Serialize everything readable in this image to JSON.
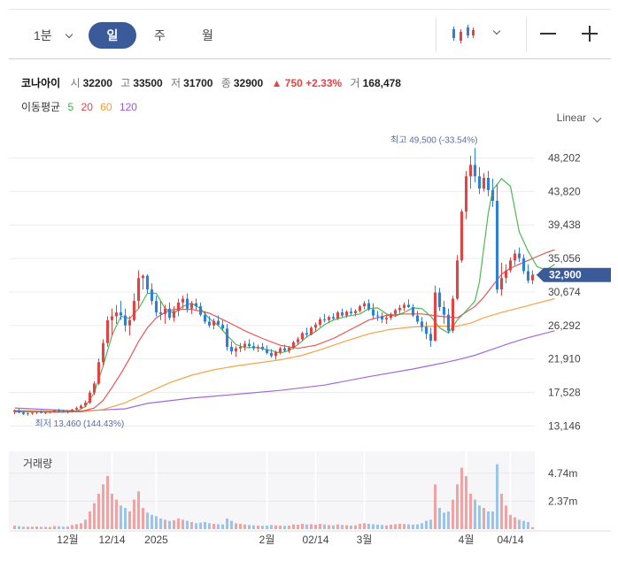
{
  "toolbar": {
    "interval_label": "1분",
    "periods": [
      "일",
      "주",
      "월"
    ],
    "active_period": "일"
  },
  "stock": {
    "name": "코나아이",
    "open_label": "시",
    "open": "32200",
    "high_label": "고",
    "high": "33500",
    "low_label": "저",
    "low": "31700",
    "close_label": "종",
    "close": "32900",
    "change": "▲ 750",
    "change_pct": "+2.33%",
    "volume_label": "거",
    "volume": "168,478"
  },
  "ma_legend": {
    "label": "이동평균",
    "items": [
      {
        "period": "5",
        "color": "#3cb043"
      },
      {
        "period": "20",
        "color": "#e64545"
      },
      {
        "period": "60",
        "color": "#f29a38"
      },
      {
        "period": "120",
        "color": "#9b59d0"
      }
    ]
  },
  "scale_mode": "Linear",
  "volume_title": "거래량",
  "colors": {
    "up": "#e04545",
    "down": "#2f7fd6",
    "accent": "#3a5a9a"
  },
  "chart_data": {
    "type": "candlestick",
    "y_ticks": [
      "48,202",
      "43,820",
      "39,438",
      "35,056",
      "30,674",
      "26,292",
      "21,910",
      "17,528",
      "13,146"
    ],
    "ylim": [
      11000,
      51500
    ],
    "current_price": "32,900",
    "high_annotation": "최고 49,500 (-33.54%)",
    "low_annotation": "최저 13,460 (144.43%)",
    "x_labels": [
      {
        "label": "12월",
        "index": 12
      },
      {
        "label": "12/14",
        "index": 22
      },
      {
        "label": "2025",
        "index": 32
      },
      {
        "label": "2월",
        "index": 57
      },
      {
        "label": "02/14",
        "index": 68
      },
      {
        "label": "3월",
        "index": 79
      },
      {
        "label": "4월",
        "index": 102
      },
      {
        "label": "04/14",
        "index": 112
      }
    ],
    "volume_ticks": [
      "4.74m",
      "2.37m"
    ],
    "volume_max": 6000000,
    "candles": [
      [
        15000,
        15300,
        14700,
        15200,
        300000
      ],
      [
        15200,
        15400,
        14800,
        14900,
        250000
      ],
      [
        14900,
        15100,
        14600,
        14700,
        220000
      ],
      [
        14700,
        14900,
        14500,
        14800,
        200000
      ],
      [
        14800,
        15000,
        14600,
        14900,
        210000
      ],
      [
        14900,
        15100,
        14700,
        15000,
        230000
      ],
      [
        15000,
        15200,
        14800,
        14850,
        200000
      ],
      [
        14850,
        15000,
        14700,
        14950,
        190000
      ],
      [
        14950,
        15100,
        14800,
        15000,
        180000
      ],
      [
        15000,
        15300,
        14900,
        15200,
        260000
      ],
      [
        15200,
        15400,
        14900,
        15100,
        240000
      ],
      [
        15100,
        15300,
        14900,
        15000,
        200000
      ],
      [
        15000,
        15200,
        14800,
        15050,
        220000
      ],
      [
        15050,
        15400,
        14900,
        15300,
        350000
      ],
      [
        15300,
        15700,
        15100,
        15500,
        420000
      ],
      [
        15500,
        16000,
        15300,
        15800,
        500000
      ],
      [
        15800,
        16500,
        15600,
        16200,
        800000
      ],
      [
        16200,
        17800,
        16000,
        17500,
        1500000
      ],
      [
        17500,
        19000,
        17200,
        18700,
        2200000
      ],
      [
        18700,
        22000,
        18500,
        21500,
        3000000
      ],
      [
        21500,
        24500,
        21000,
        24000,
        3800000
      ],
      [
        24000,
        27500,
        23500,
        27000,
        4500000
      ],
      [
        27000,
        28500,
        25000,
        27500,
        3000000
      ],
      [
        27500,
        29000,
        26500,
        28000,
        2500000
      ],
      [
        28000,
        29500,
        27000,
        27600,
        2000000
      ],
      [
        27600,
        28500,
        25500,
        26300,
        1800000
      ],
      [
        26300,
        27500,
        25000,
        27000,
        1500000
      ],
      [
        27000,
        30500,
        26800,
        29500,
        2500000
      ],
      [
        29500,
        33500,
        28500,
        32500,
        3200000
      ],
      [
        32500,
        33000,
        31000,
        32800,
        1800000
      ],
      [
        32800,
        33000,
        30500,
        31000,
        1400000
      ],
      [
        31000,
        31800,
        29000,
        29500,
        1200000
      ],
      [
        29500,
        30200,
        27500,
        28000,
        1100000
      ],
      [
        28000,
        29500,
        27000,
        27800,
        900000
      ],
      [
        27800,
        29000,
        26500,
        28500,
        800000
      ],
      [
        28500,
        29300,
        27000,
        27300,
        700000
      ],
      [
        27300,
        28800,
        26800,
        28200,
        750000
      ],
      [
        28200,
        29800,
        27500,
        29300,
        900000
      ],
      [
        29300,
        30200,
        28500,
        29800,
        800000
      ],
      [
        29800,
        30500,
        28000,
        28500,
        700000
      ],
      [
        28500,
        29500,
        27800,
        29200,
        600000
      ],
      [
        29200,
        29800,
        28300,
        28800,
        500000
      ],
      [
        28800,
        29300,
        27500,
        27700,
        550000
      ],
      [
        27700,
        28200,
        26500,
        26800,
        600000
      ],
      [
        26800,
        27500,
        26000,
        26300,
        500000
      ],
      [
        26300,
        27200,
        25800,
        26900,
        450000
      ],
      [
        26900,
        27600,
        26200,
        26400,
        420000
      ],
      [
        26400,
        27000,
        25600,
        25900,
        400000
      ],
      [
        25900,
        26500,
        23000,
        23500,
        900000
      ],
      [
        23500,
        24200,
        22500,
        22900,
        700000
      ],
      [
        22900,
        23600,
        22200,
        23300,
        500000
      ],
      [
        23300,
        24000,
        22800,
        23500,
        450000
      ],
      [
        23500,
        24300,
        23000,
        23900,
        400000
      ],
      [
        23900,
        24500,
        23300,
        23600,
        350000
      ],
      [
        23600,
        24100,
        23000,
        23300,
        320000
      ],
      [
        23300,
        23800,
        22800,
        23500,
        300000
      ],
      [
        23500,
        24000,
        23000,
        23200,
        280000
      ],
      [
        23200,
        23700,
        22500,
        22700,
        300000
      ],
      [
        22700,
        23200,
        22100,
        22300,
        350000
      ],
      [
        22300,
        23000,
        21800,
        22800,
        320000
      ],
      [
        22800,
        23500,
        22500,
        23300,
        300000
      ],
      [
        23300,
        23800,
        22800,
        23000,
        280000
      ],
      [
        23000,
        23600,
        22700,
        23400,
        300000
      ],
      [
        23400,
        24300,
        23200,
        24100,
        400000
      ],
      [
        24100,
        24800,
        23800,
        24500,
        380000
      ],
      [
        24500,
        25500,
        24300,
        25300,
        450000
      ],
      [
        25300,
        26000,
        24800,
        25100,
        400000
      ],
      [
        25100,
        26200,
        25000,
        26000,
        420000
      ],
      [
        26000,
        26700,
        25500,
        26400,
        380000
      ],
      [
        26400,
        27400,
        26100,
        27100,
        450000
      ],
      [
        27100,
        27800,
        26700,
        27000,
        400000
      ],
      [
        27000,
        27600,
        26600,
        27400,
        350000
      ],
      [
        27400,
        27900,
        27000,
        27200,
        320000
      ],
      [
        27200,
        28200,
        27000,
        28000,
        400000
      ],
      [
        28000,
        28500,
        27400,
        27600,
        350000
      ],
      [
        27600,
        28300,
        27300,
        28100,
        330000
      ],
      [
        28100,
        28600,
        27600,
        27900,
        300000
      ],
      [
        27900,
        28400,
        27500,
        28200,
        320000
      ],
      [
        28200,
        29000,
        28000,
        28800,
        450000
      ],
      [
        28800,
        29500,
        28400,
        29200,
        500000
      ],
      [
        29200,
        29700,
        28200,
        28400,
        450000
      ],
      [
        28400,
        29200,
        27200,
        27600,
        420000
      ],
      [
        27600,
        28200,
        26900,
        27500,
        380000
      ],
      [
        27500,
        28000,
        26600,
        27100,
        350000
      ],
      [
        27100,
        27700,
        26500,
        27300,
        320000
      ],
      [
        27300,
        28000,
        27000,
        27800,
        380000
      ],
      [
        27800,
        28500,
        27400,
        28300,
        420000
      ],
      [
        28300,
        29000,
        27800,
        28600,
        450000
      ],
      [
        28600,
        29300,
        28200,
        29000,
        430000
      ],
      [
        29000,
        29700,
        28600,
        28700,
        400000
      ],
      [
        28700,
        29100,
        27400,
        27600,
        380000
      ],
      [
        27600,
        28200,
        26500,
        26800,
        400000
      ],
      [
        26800,
        27400,
        25500,
        26100,
        500000
      ],
      [
        26100,
        26800,
        24500,
        25200,
        700000
      ],
      [
        25200,
        26000,
        23500,
        24300,
        800000
      ],
      [
        24300,
        31500,
        24200,
        30600,
        3800000
      ],
      [
        30600,
        31200,
        28200,
        28700,
        1800000
      ],
      [
        28700,
        29500,
        26500,
        27700,
        1400000
      ],
      [
        27700,
        28500,
        25300,
        25600,
        1500000
      ],
      [
        25600,
        30200,
        25300,
        29800,
        2500000
      ],
      [
        29800,
        35500,
        29600,
        34800,
        3800000
      ],
      [
        34800,
        41500,
        34500,
        41200,
        5200000
      ],
      [
        41200,
        46500,
        40200,
        45800,
        4500000
      ],
      [
        45800,
        48500,
        44200,
        47300,
        3000000
      ],
      [
        47300,
        49500,
        45000,
        45800,
        2500000
      ],
      [
        45800,
        47000,
        43500,
        44200,
        2000000
      ],
      [
        44200,
        46200,
        43800,
        45600,
        1800000
      ],
      [
        45600,
        46500,
        43200,
        44000,
        1500000
      ],
      [
        44000,
        45500,
        41800,
        42600,
        1500000
      ],
      [
        42600,
        44800,
        30500,
        31000,
        5500000
      ],
      [
        31000,
        34500,
        30200,
        32500,
        3000000
      ],
      [
        32500,
        34300,
        31800,
        33500,
        2000000
      ],
      [
        33500,
        35200,
        33200,
        34800,
        1200000
      ],
      [
        34800,
        36200,
        34200,
        35700,
        1000000
      ],
      [
        35700,
        36500,
        34600,
        35100,
        800000
      ],
      [
        35100,
        35600,
        33000,
        33400,
        700000
      ],
      [
        33400,
        34300,
        31800,
        32150,
        600000
      ],
      [
        32200,
        33500,
        31700,
        32900,
        168478
      ]
    ],
    "ma5": [
      [
        0,
        15000
      ],
      [
        10,
        15000
      ],
      [
        14,
        15100
      ],
      [
        16,
        15700
      ],
      [
        18,
        17500
      ],
      [
        20,
        21000
      ],
      [
        22,
        25000
      ],
      [
        24,
        27500
      ],
      [
        26,
        27200
      ],
      [
        28,
        28500
      ],
      [
        30,
        30500
      ],
      [
        32,
        30500
      ],
      [
        34,
        28500
      ],
      [
        36,
        27900
      ],
      [
        38,
        28800
      ],
      [
        40,
        29200
      ],
      [
        42,
        28500
      ],
      [
        44,
        27200
      ],
      [
        46,
        26300
      ],
      [
        48,
        25000
      ],
      [
        50,
        23800
      ],
      [
        52,
        23400
      ],
      [
        55,
        23400
      ],
      [
        58,
        23000
      ],
      [
        60,
        22700
      ],
      [
        62,
        23000
      ],
      [
        64,
        23800
      ],
      [
        66,
        24800
      ],
      [
        68,
        25500
      ],
      [
        70,
        26400
      ],
      [
        72,
        27000
      ],
      [
        75,
        27500
      ],
      [
        78,
        27800
      ],
      [
        80,
        28500
      ],
      [
        82,
        28600
      ],
      [
        84,
        27800
      ],
      [
        86,
        27500
      ],
      [
        88,
        28000
      ],
      [
        90,
        28600
      ],
      [
        92,
        28500
      ],
      [
        94,
        27500
      ],
      [
        96,
        26000
      ],
      [
        98,
        25300
      ],
      [
        100,
        27000
      ],
      [
        102,
        28200
      ],
      [
        104,
        29500
      ],
      [
        105,
        32000
      ],
      [
        106,
        36500
      ],
      [
        107,
        41000
      ],
      [
        108,
        44000
      ],
      [
        110,
        45500
      ],
      [
        112,
        44500
      ],
      [
        114,
        38500
      ],
      [
        116,
        36000
      ],
      [
        118,
        34000
      ],
      [
        120,
        33500
      ],
      [
        122,
        34300
      ]
    ],
    "ma20": [
      [
        0,
        15100
      ],
      [
        10,
        14950
      ],
      [
        15,
        15050
      ],
      [
        18,
        15500
      ],
      [
        20,
        16500
      ],
      [
        22,
        18200
      ],
      [
        24,
        20000
      ],
      [
        26,
        22000
      ],
      [
        28,
        24200
      ],
      [
        30,
        26000
      ],
      [
        32,
        27300
      ],
      [
        34,
        28000
      ],
      [
        36,
        28400
      ],
      [
        40,
        28400
      ],
      [
        44,
        27900
      ],
      [
        48,
        26800
      ],
      [
        52,
        25600
      ],
      [
        56,
        24600
      ],
      [
        60,
        23700
      ],
      [
        64,
        23300
      ],
      [
        68,
        23700
      ],
      [
        72,
        24600
      ],
      [
        76,
        25800
      ],
      [
        80,
        27000
      ],
      [
        84,
        27600
      ],
      [
        88,
        27800
      ],
      [
        92,
        27800
      ],
      [
        96,
        27500
      ],
      [
        100,
        27300
      ],
      [
        104,
        28800
      ],
      [
        106,
        30000
      ],
      [
        108,
        31500
      ],
      [
        110,
        33000
      ],
      [
        112,
        33800
      ],
      [
        114,
        34300
      ],
      [
        116,
        34800
      ],
      [
        118,
        35300
      ],
      [
        120,
        35800
      ],
      [
        122,
        36200
      ]
    ],
    "ma60": [
      [
        0,
        15200
      ],
      [
        15,
        15000
      ],
      [
        20,
        15300
      ],
      [
        25,
        16200
      ],
      [
        30,
        17500
      ],
      [
        35,
        18800
      ],
      [
        40,
        19800
      ],
      [
        45,
        20500
      ],
      [
        50,
        21000
      ],
      [
        55,
        21400
      ],
      [
        60,
        21800
      ],
      [
        65,
        22400
      ],
      [
        70,
        23300
      ],
      [
        75,
        24300
      ],
      [
        80,
        25200
      ],
      [
        85,
        25800
      ],
      [
        90,
        26100
      ],
      [
        95,
        26200
      ],
      [
        100,
        26200
      ],
      [
        103,
        26600
      ],
      [
        106,
        27300
      ],
      [
        110,
        28000
      ],
      [
        114,
        28600
      ],
      [
        118,
        29200
      ],
      [
        122,
        29800
      ]
    ],
    "ma120": [
      [
        0,
        15500
      ],
      [
        15,
        15100
      ],
      [
        25,
        15400
      ],
      [
        30,
        16100
      ],
      [
        40,
        16800
      ],
      [
        50,
        17300
      ],
      [
        60,
        17800
      ],
      [
        70,
        18500
      ],
      [
        80,
        19600
      ],
      [
        90,
        20600
      ],
      [
        96,
        21300
      ],
      [
        100,
        21800
      ],
      [
        104,
        22400
      ],
      [
        108,
        23200
      ],
      [
        112,
        24000
      ],
      [
        116,
        24700
      ],
      [
        120,
        25300
      ],
      [
        122,
        25600
      ]
    ]
  }
}
